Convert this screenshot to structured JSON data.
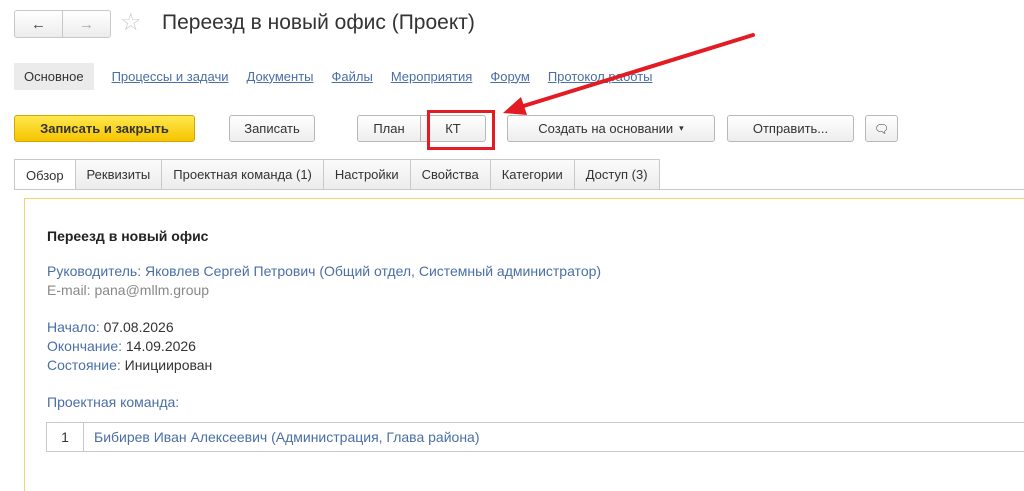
{
  "window": {
    "back_glyph": "←",
    "forward_glyph": "→",
    "star_glyph": "☆",
    "title": "Переезд в новый офис (Проект)"
  },
  "nav": {
    "active": "Основное",
    "links": [
      "Процессы и задачи",
      "Документы",
      "Файлы",
      "Мероприятия",
      "Форум",
      "Протокол работы"
    ]
  },
  "toolbar": {
    "save_close": "Записать и закрыть",
    "save": "Записать",
    "plan": "План",
    "kt": "КТ",
    "create_based": "Создать на основании",
    "send": "Отправить...",
    "caret": "▾",
    "chat_glyph": "🗨"
  },
  "tabs": [
    "Обзор",
    "Реквизиты",
    "Проектная команда (1)",
    "Настройки",
    "Свойства",
    "Категории",
    "Доступ (3)"
  ],
  "overview": {
    "heading": "Переезд в новый офис",
    "manager_label": "Руководитель:",
    "manager_value": "Яковлев Сергей Петрович (Общий отдел, Системный администратор)",
    "email_label": "E-mail:",
    "email_value": "pana@mllm.group",
    "start_label": "Начало:",
    "start_value": "07.08.2026",
    "end_label": "Окончание:",
    "end_value": "14.09.2026",
    "state_label": "Состояние:",
    "state_value": "Инициирован",
    "team_label": "Проектная команда:",
    "team": [
      {
        "num": "1",
        "name": "Бибирев Иван Алексеевич (Администрация, Глава района)"
      }
    ]
  },
  "colors": {
    "accent_yellow": "#f5c400",
    "link_blue": "#4a6fa5",
    "annotation_red": "#e31b23"
  }
}
